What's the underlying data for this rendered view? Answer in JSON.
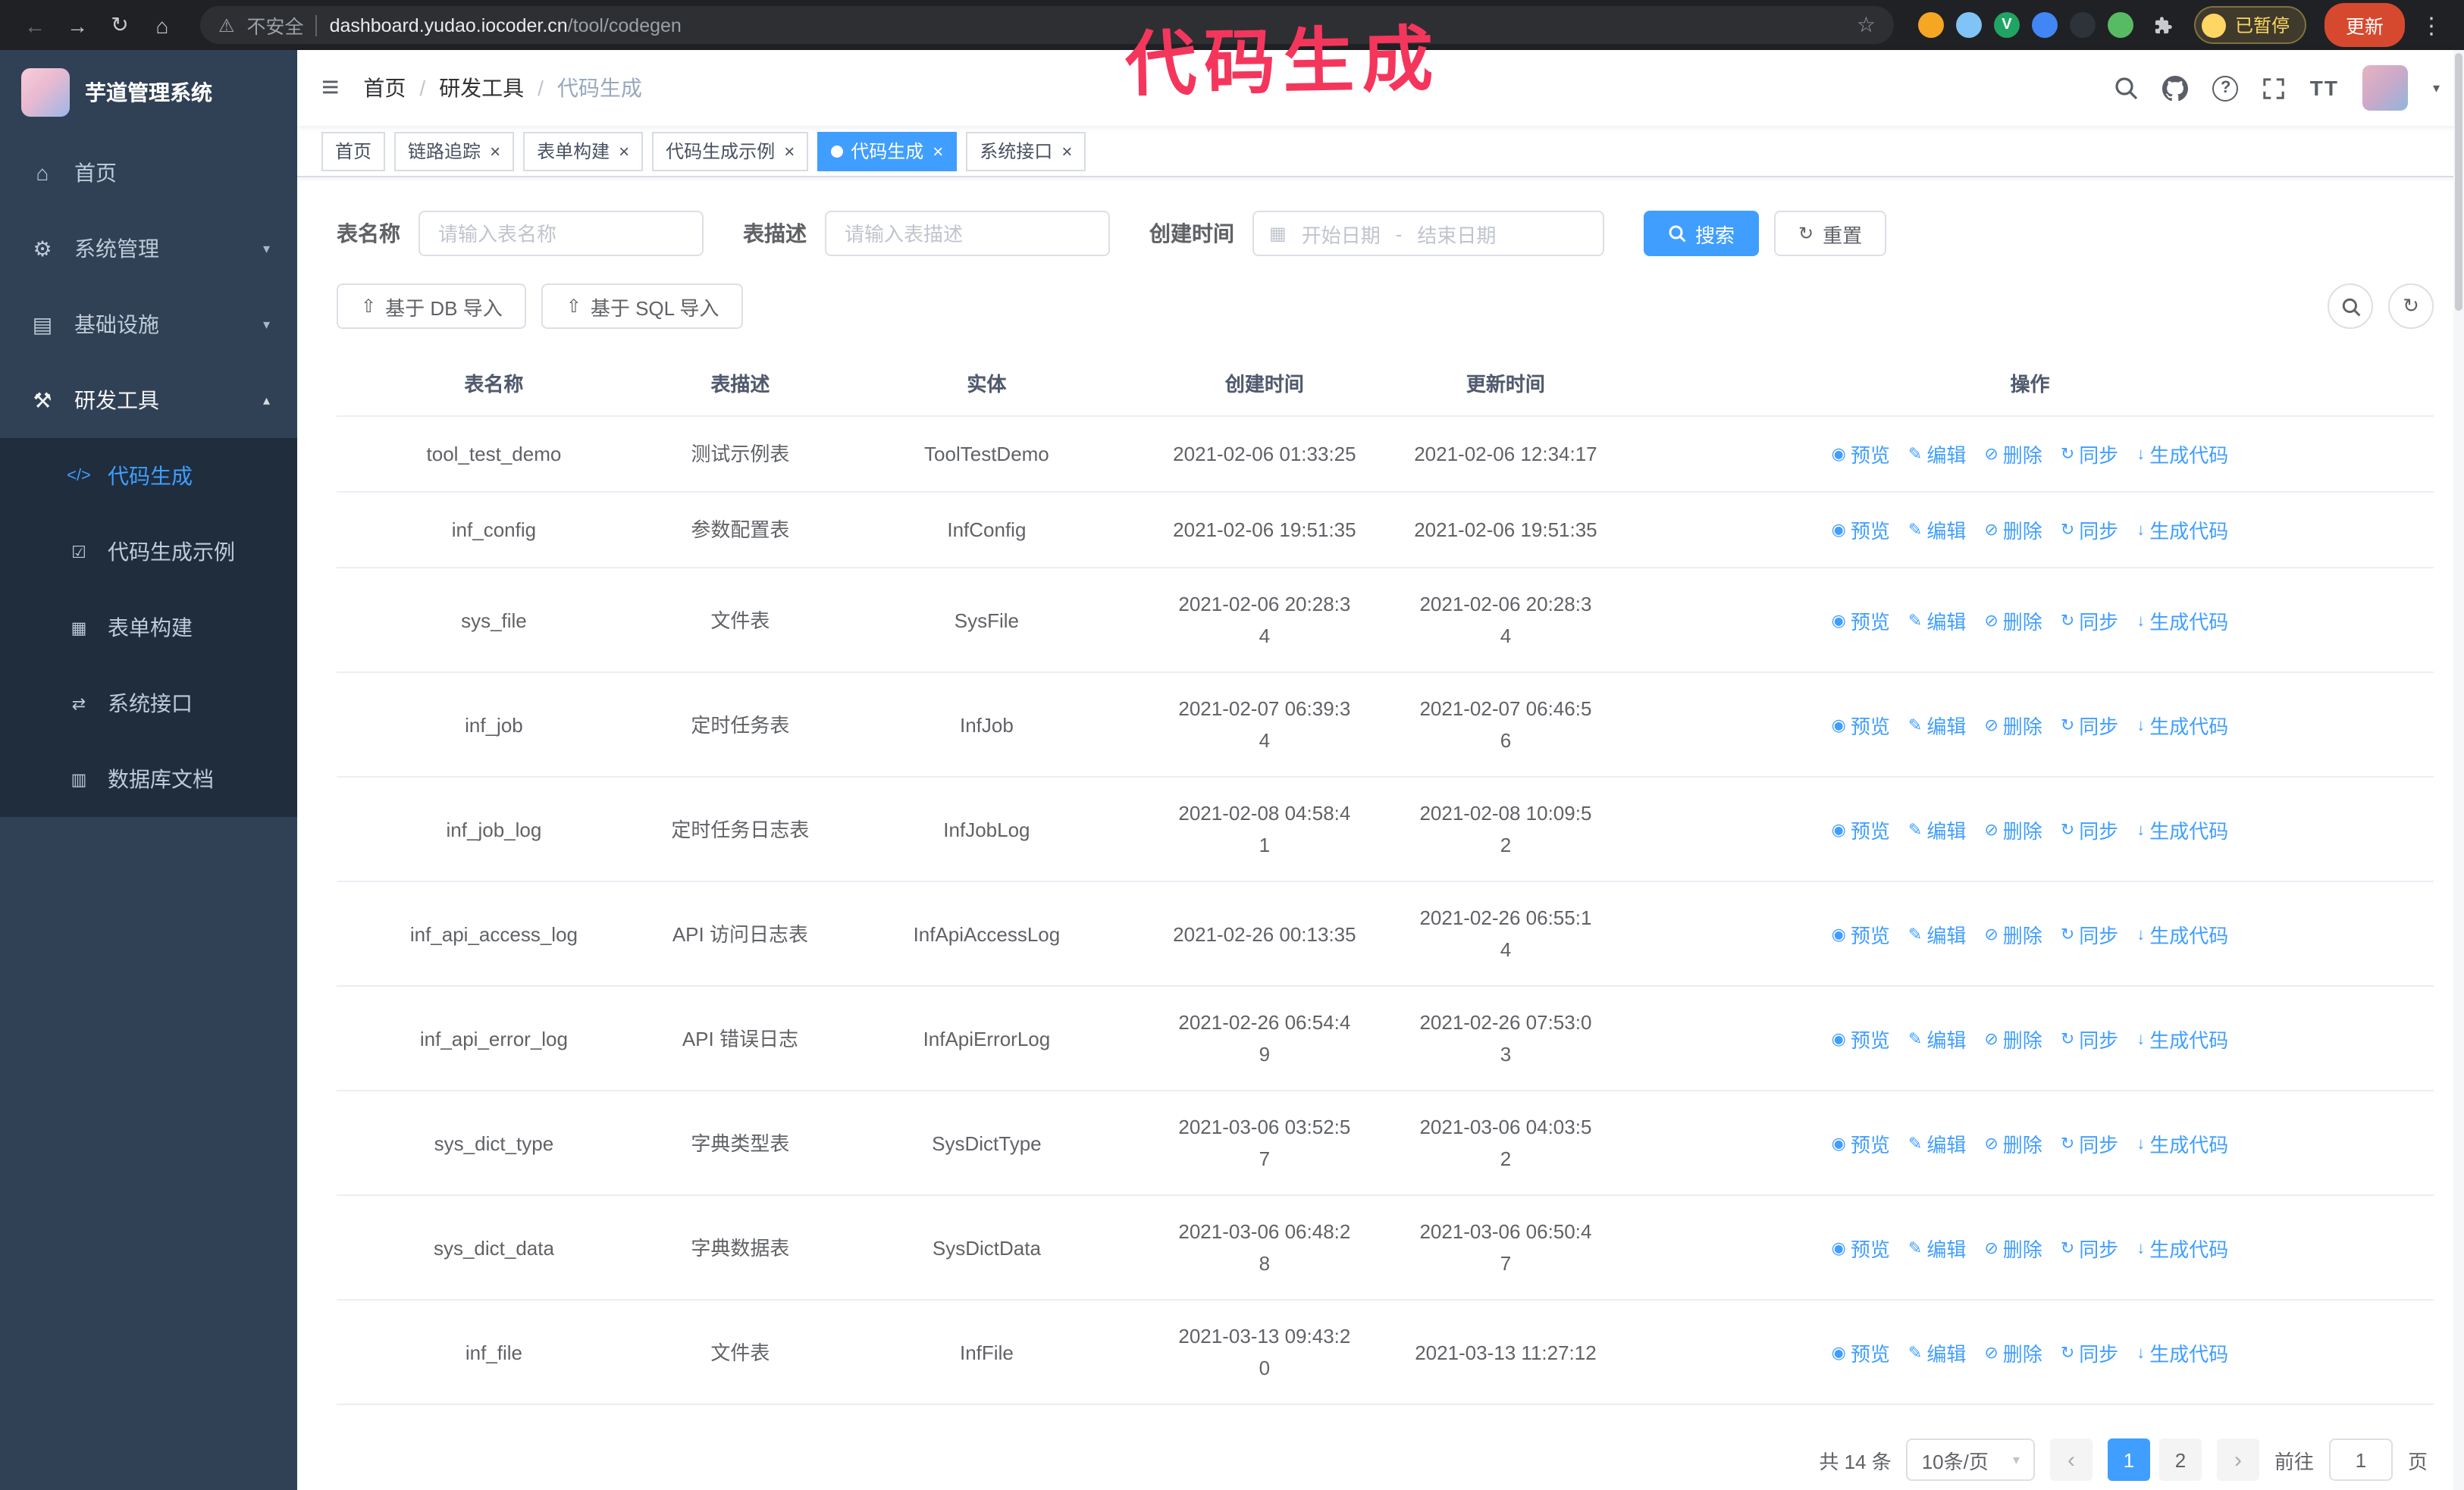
{
  "palette": {
    "accent": "#409EFF",
    "link": "#409EFF",
    "sidebar_bg": "#304156",
    "submenu_bg": "#1F2D3D",
    "sidebar_text": "#BFCBD9",
    "chrome_bg": "#202124",
    "update_button_bg": "#D6492F",
    "paused_color": "#FDD663",
    "annotation": "#F5365C"
  },
  "icons": {
    "back": "←",
    "forward": "→",
    "reload": "↻",
    "home": "⌂",
    "warning": "⚠",
    "star": "☆",
    "kebab": "⋮",
    "hamburger": "≡",
    "caret_down": "▾",
    "chevron_down": "▾",
    "chevron_up": "▴",
    "calendar": "▦",
    "reset": "↻",
    "import": "⇧",
    "help": "?",
    "font_size": "TT",
    "close": "×",
    "prev": "‹",
    "next": "›"
  },
  "annotation": {
    "text": "代码生成"
  },
  "browser": {
    "security_label": "不安全",
    "url_host": "dashboard.yudao.iocoder.cn",
    "url_path": "/tool/codegen",
    "profile_chip": "已暂停",
    "update_button": "更新",
    "extensions": [
      {
        "name": "extension-icon-orange",
        "color": "#F5A623",
        "glyph": ""
      },
      {
        "name": "extension-icon-lightblue",
        "color": "#7FC3F7",
        "glyph": ""
      },
      {
        "name": "extension-icon-green-v",
        "color": "#21A366",
        "glyph": "V"
      },
      {
        "name": "extension-icon-blue-grid",
        "color": "#4285F4",
        "glyph": ""
      },
      {
        "name": "extension-icon-dark-green",
        "color": "#2D333B",
        "glyph": ""
      },
      {
        "name": "extension-icon-leaf",
        "color": "#57BB63",
        "glyph": ""
      }
    ]
  },
  "sidebar": {
    "title": "芋道管理系统",
    "menu": [
      {
        "name": "home",
        "label": "首页",
        "icon": "home-icon",
        "glyph": "⌂"
      },
      {
        "name": "system-management",
        "label": "系统管理",
        "icon": "gear-icon",
        "glyph": "⚙",
        "chevron": "down"
      },
      {
        "name": "infrastructure",
        "label": "基础设施",
        "icon": "infrastructure-icon",
        "glyph": "▤",
        "chevron": "down"
      },
      {
        "name": "dev-tools",
        "label": "研发工具",
        "icon": "dev-tools-icon",
        "glyph": "⚒",
        "chevron": "up",
        "expanded": true
      }
    ],
    "submenu": [
      {
        "name": "codegen",
        "label": "代码生成",
        "icon": "code-icon",
        "glyph": "</>",
        "active": true
      },
      {
        "name": "codegen-example",
        "label": "代码生成示例",
        "icon": "example-icon",
        "glyph": "☑"
      },
      {
        "name": "form-builder",
        "label": "表单构建",
        "icon": "form-builder-icon",
        "glyph": "▦"
      },
      {
        "name": "system-api",
        "label": "系统接口",
        "icon": "api-icon",
        "glyph": "⇄"
      },
      {
        "name": "db-doc",
        "label": "数据库文档",
        "icon": "db-doc-icon",
        "glyph": "▥"
      }
    ]
  },
  "header": {
    "breadcrumb": [
      {
        "label": "首页"
      },
      {
        "label": "研发工具"
      },
      {
        "label": "代码生成",
        "current": true
      }
    ]
  },
  "tabs": [
    {
      "label": "首页",
      "closable": false,
      "active": false
    },
    {
      "label": "链路追踪",
      "closable": true,
      "active": false
    },
    {
      "label": "表单构建",
      "closable": true,
      "active": false
    },
    {
      "label": "代码生成示例",
      "closable": true,
      "active": false
    },
    {
      "label": "代码生成",
      "closable": true,
      "active": true
    },
    {
      "label": "系统接口",
      "closable": true,
      "active": false
    }
  ],
  "filters": {
    "table_name_label": "表名称",
    "table_name_placeholder": "请输入表名称",
    "table_desc_label": "表描述",
    "table_desc_placeholder": "请输入表描述",
    "create_time_label": "创建时间",
    "start_date_placeholder": "开始日期",
    "range_separator": "-",
    "end_date_placeholder": "结束日期",
    "search_label": "搜索",
    "reset_label": "重置"
  },
  "toolbar": {
    "import_db": "基于 DB 导入",
    "import_sql": "基于 SQL 导入"
  },
  "table": {
    "columns": [
      "表名称",
      "表描述",
      "实体",
      "创建时间",
      "更新时间",
      "操作"
    ],
    "actions": [
      {
        "name": "preview",
        "label": "预览",
        "icon": "preview-icon",
        "glyph": "◉"
      },
      {
        "name": "edit",
        "label": "编辑",
        "icon": "edit-icon",
        "glyph": "✎"
      },
      {
        "name": "delete",
        "label": "删除",
        "icon": "delete-icon",
        "glyph": "⊘"
      },
      {
        "name": "sync",
        "label": "同步",
        "icon": "sync-icon",
        "glyph": "↻"
      },
      {
        "name": "generate",
        "label": "生成代码",
        "icon": "generate-code-icon",
        "glyph": "↓"
      }
    ],
    "rows": [
      {
        "name": "tool_test_demo",
        "description": "测试示例表",
        "entity": "ToolTestDemo",
        "create_time": "2021-02-06 01:33:25",
        "update_time": "2021-02-06 12:34:17"
      },
      {
        "name": "inf_config",
        "description": "参数配置表",
        "entity": "InfConfig",
        "create_time": "2021-02-06 19:51:35",
        "update_time": "2021-02-06 19:51:35"
      },
      {
        "name": "sys_file",
        "description": "文件表",
        "entity": "SysFile",
        "create_time": "2021-02-06 20:28:3\n4",
        "update_time": "2021-02-06 20:28:3\n4"
      },
      {
        "name": "inf_job",
        "description": "定时任务表",
        "entity": "InfJob",
        "create_time": "2021-02-07 06:39:3\n4",
        "update_time": "2021-02-07 06:46:5\n6"
      },
      {
        "name": "inf_job_log",
        "description": "定时任务日志表",
        "entity": "InfJobLog",
        "create_time": "2021-02-08 04:58:4\n1",
        "update_time": "2021-02-08 10:09:5\n2"
      },
      {
        "name": "inf_api_access_log",
        "description": "API 访问日志表",
        "entity": "InfApiAccessLog",
        "create_time": "2021-02-26 00:13:35",
        "update_time": "2021-02-26 06:55:1\n4"
      },
      {
        "name": "inf_api_error_log",
        "description": "API 错误日志",
        "entity": "InfApiErrorLog",
        "create_time": "2021-02-26 06:54:4\n9",
        "update_time": "2021-02-26 07:53:0\n3"
      },
      {
        "name": "sys_dict_type",
        "description": "字典类型表",
        "entity": "SysDictType",
        "create_time": "2021-03-06 03:52:5\n7",
        "update_time": "2021-03-06 04:03:5\n2"
      },
      {
        "name": "sys_dict_data",
        "description": "字典数据表",
        "entity": "SysDictData",
        "create_time": "2021-03-06 06:48:2\n8",
        "update_time": "2021-03-06 06:50:4\n7"
      },
      {
        "name": "inf_file",
        "description": "文件表",
        "entity": "InfFile",
        "create_time": "2021-03-13 09:43:2\n0",
        "update_time": "2021-03-13 11:27:12"
      }
    ]
  },
  "pagination": {
    "total": "共 14 条",
    "page_size": "10条/页",
    "pages": [
      {
        "label": "1",
        "active": true
      },
      {
        "label": "2",
        "active": false
      }
    ],
    "goto_label": "前往",
    "goto_value": "1",
    "goto_suffix": "页"
  }
}
